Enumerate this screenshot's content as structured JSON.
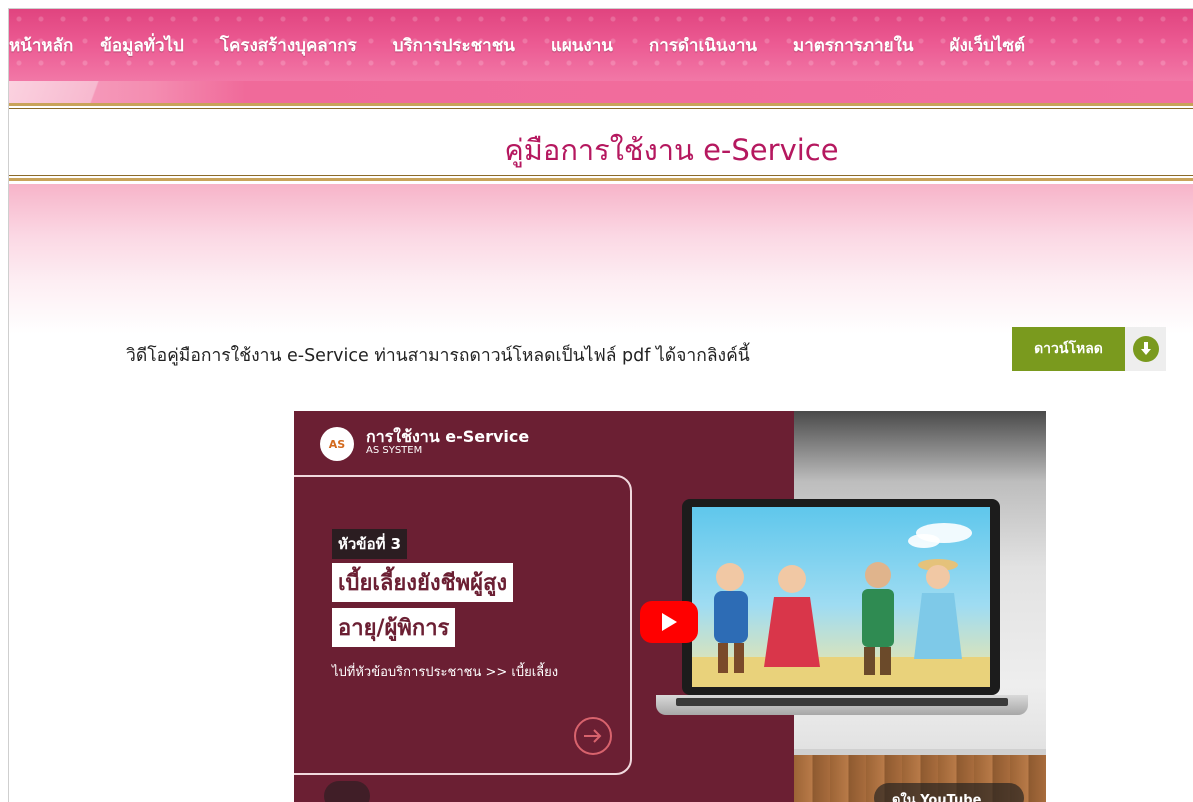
{
  "nav": {
    "items": [
      "หน้าหลัก",
      "ข้อมูลทั่วไป",
      "โครงสร้างบุคลากร",
      "บริการประชาชน",
      "แผนงาน",
      "การดำเนินงาน",
      "มาตรการภายใน",
      "ผังเว็บไซต์"
    ]
  },
  "page": {
    "title": "คู่มือการใช้งาน e-Service",
    "intro": "วิดีโอคู่มือการใช้งาน e-Service ท่านสามารถดาวน์โหลดเป็นไฟล์ pdf ได้จากลิงค์นี้"
  },
  "download": {
    "label": "ดาวน์โหลด",
    "icon": "download-circle-icon"
  },
  "video": {
    "channel_logo": "AS",
    "channel_title": "การใช้งาน e-Service",
    "channel_sub": "AS SYSTEM",
    "topic_tag": "หัวข้อที่ 3",
    "headline_line1": "เบี้ยเลี้ยงยังชีพผู้สูง",
    "headline_line2": "อายุ/ผู้พิการ",
    "hint": "ไปที่หัวข้อบริการประชาชน >> เบี้ยเลี้ยง",
    "youtube_label": "ดูใน YouTube",
    "icons": [
      "play-icon",
      "arrow-right-icon",
      "share-icon",
      "youtube-logo-icon"
    ]
  },
  "colors": {
    "nav_pink": "#ec5b93",
    "title_magenta": "#b5185f",
    "gold_rule": "#c9a35a",
    "download_green": "#7a9a1e",
    "video_maroon": "#6b1f33",
    "youtube_red": "#ff0000"
  }
}
